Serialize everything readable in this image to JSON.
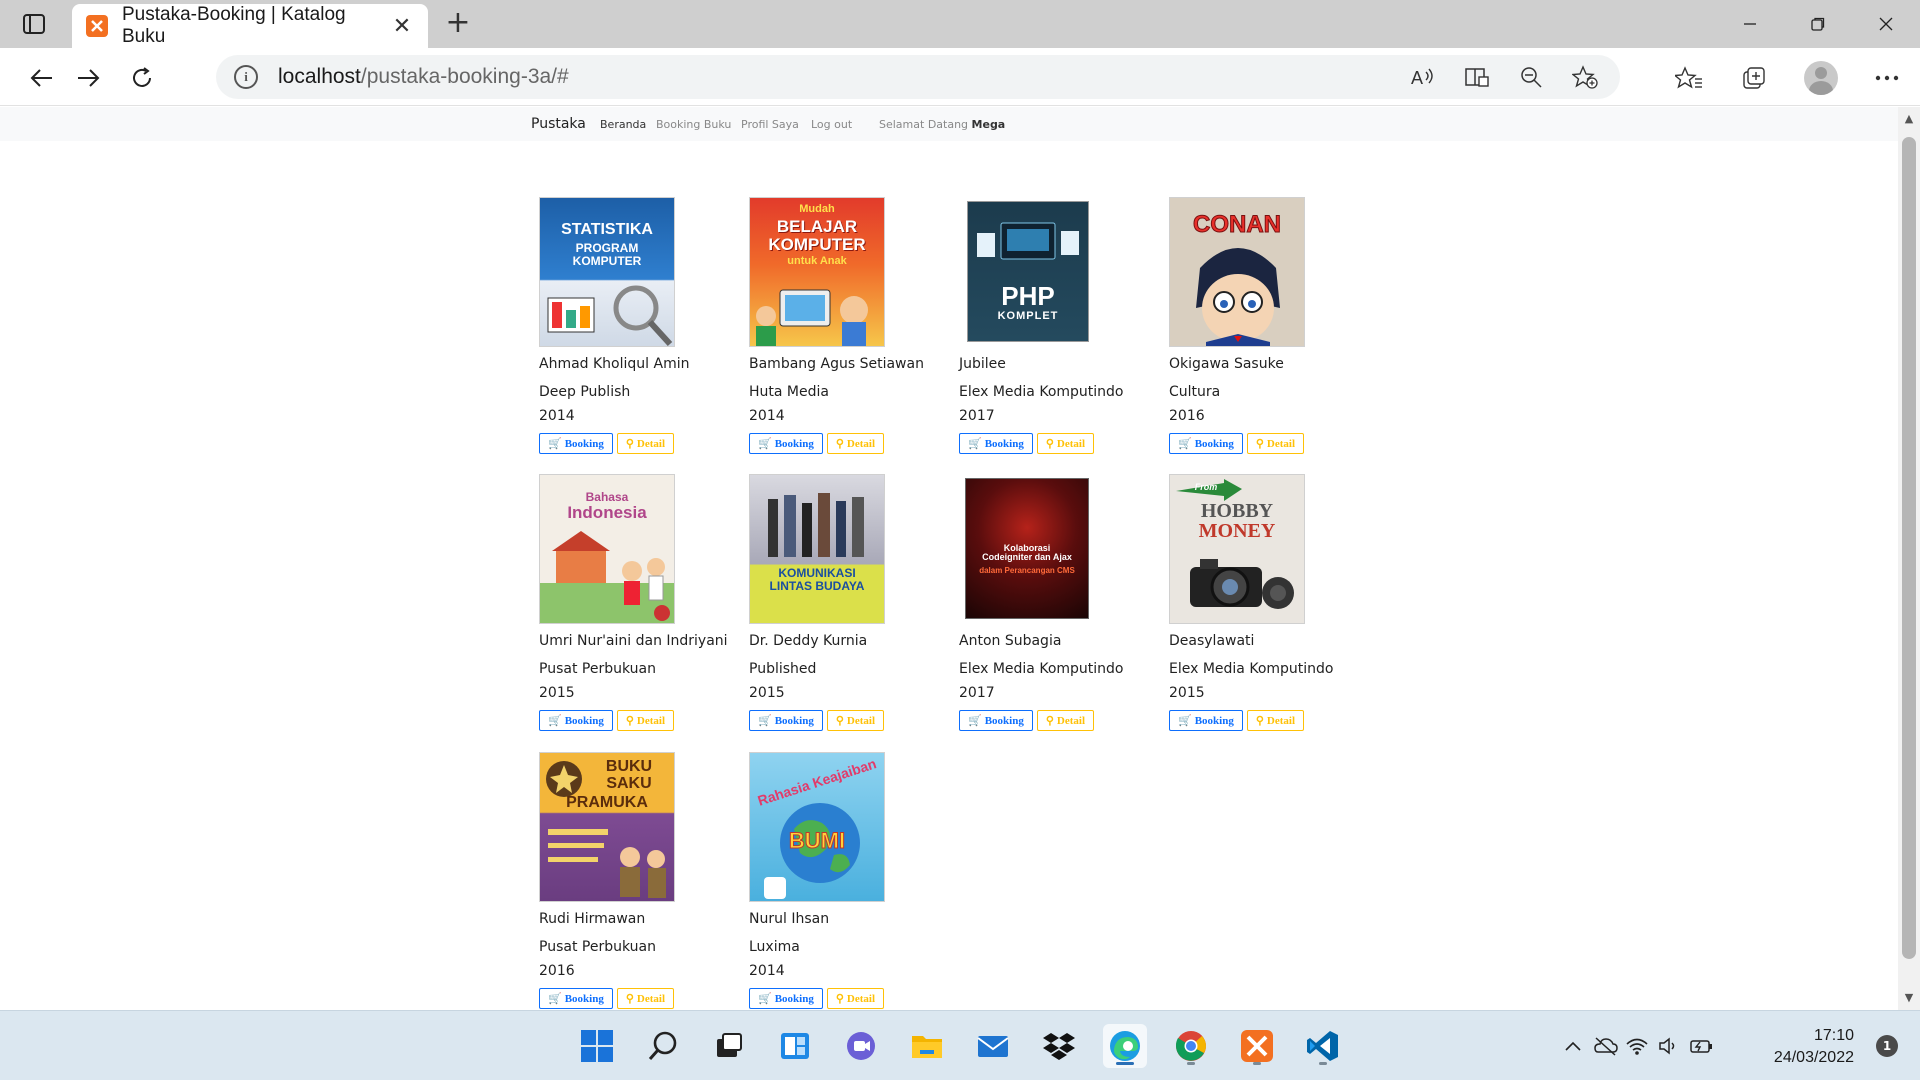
{
  "browser": {
    "tab_title": "Pustaka-Booking | Katalog Buku",
    "url_host": "localhost",
    "url_path": "/pustaka-booking-3a/#"
  },
  "site_nav": {
    "brand": "Pustaka",
    "links": [
      "Beranda",
      "Booking Buku",
      "Profil Saya",
      "Log out"
    ],
    "welcome_prefix": "Selamat Datang",
    "welcome_user": "Mega"
  },
  "buttons": {
    "booking_label": "Booking",
    "detail_label": "Detail"
  },
  "books": [
    {
      "author": "Ahmad Kholiqul Amin",
      "publisher": "Deep Publish",
      "year": "2014",
      "cover_text": "STATISTIKA PROGRAM KOMPUTER",
      "cover_color": "#1d5fa7"
    },
    {
      "author": "Bambang Agus Setiawan",
      "publisher": "Huta Media",
      "year": "2014",
      "cover_text": "Mudah BELAJAR KOMPUTER untuk Anak",
      "cover_color": "#e23b2b"
    },
    {
      "author": "Jubilee",
      "publisher": "Elex Media Komputindo",
      "year": "2017",
      "cover_text": "PHP KOMPLET",
      "cover_color": "#1c3b4d"
    },
    {
      "author": "Okigawa Sasuke",
      "publisher": "Cultura",
      "year": "2016",
      "cover_text": "CONAN",
      "cover_color": "#d9cfc0"
    },
    {
      "author": "Umri Nur'aini dan Indriyani",
      "publisher": "Pusat Perbukuan",
      "year": "2015",
      "cover_text": "Bahasa Indonesia",
      "cover_color": "#f3eee6"
    },
    {
      "author": "Dr. Deddy Kurnia",
      "publisher": "Published",
      "year": "2015",
      "cover_text": "KOMUNIKASI LINTAS BUDAYA",
      "cover_color": "#dcdce4"
    },
    {
      "author": "Anton Subagia",
      "publisher": "Elex Media Komputindo",
      "year": "2017",
      "cover_text": "Kolaborasi Codeigniter dan Ajax",
      "cover_color": "#2a0c0c"
    },
    {
      "author": "Deasylawati",
      "publisher": "Elex Media Komputindo",
      "year": "2015",
      "cover_text": "From HOBBY to MONEY",
      "cover_color": "#eae6e0"
    },
    {
      "author": "Rudi Hirmawan",
      "publisher": "Pusat Perbukuan",
      "year": "2016",
      "cover_text": "BUKU SAKU PRAMUKA",
      "cover_color": "#7e4b93"
    },
    {
      "author": "Nurul Ihsan",
      "publisher": "Luxima",
      "year": "2014",
      "cover_text": "Rahasia Keajaiban BUMI",
      "cover_color": "#4ab0de"
    }
  ],
  "taskbar": {
    "apps": [
      "start-icon",
      "search-icon",
      "task-view-icon",
      "widgets-icon",
      "chat-icon",
      "file-explorer-icon",
      "mail-icon",
      "dropbox-icon",
      "edge-icon",
      "chrome-icon",
      "xampp-icon",
      "vscode-icon"
    ],
    "time": "17:10",
    "date": "24/03/2022",
    "notification_count": "1"
  }
}
